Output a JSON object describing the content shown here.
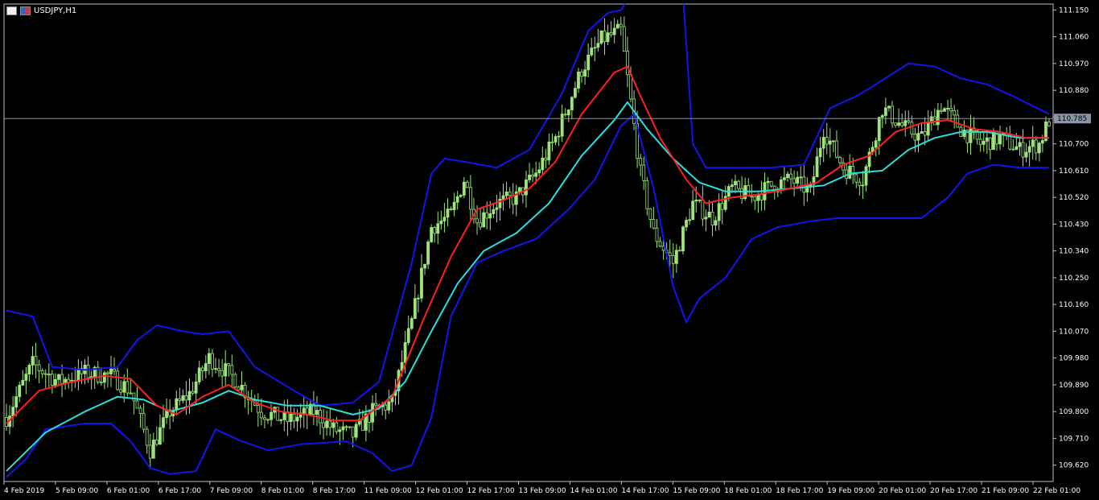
{
  "window": {
    "symbol_title": "USDJPY,H1",
    "icons": [
      "chart-window-icon",
      "flag-icon"
    ]
  },
  "colors": {
    "background": "#000000",
    "frame": "#c0c0c0",
    "candle_body": "#9ee57a",
    "candle_bear": "#000000",
    "bollinger": "#1414f0",
    "ma_fast": "#ff2020",
    "ma_slow": "#28e0e0",
    "price_line": "#8a96a8",
    "price_label_bg": "#8a96a8"
  },
  "chart_data": {
    "type": "candlestick",
    "symbol": "USDJPY",
    "timeframe": "H1",
    "current_price": 110.785,
    "y_range": [
      109.565,
      111.17
    ],
    "y_ticks": [
      "111.150",
      "111.060",
      "110.970",
      "110.880",
      "110.790",
      "110.700",
      "110.610",
      "110.520",
      "110.430",
      "110.340",
      "110.250",
      "110.160",
      "110.070",
      "109.980",
      "109.890",
      "109.800",
      "109.710",
      "109.620"
    ],
    "x_ticks": [
      "4 Feb 2019",
      "5 Feb 09:00",
      "6 Feb 01:00",
      "6 Feb 17:00",
      "7 Feb 09:00",
      "8 Feb 01:00",
      "8 Feb 17:00",
      "11 Feb 09:00",
      "12 Feb 01:00",
      "12 Feb 17:00",
      "13 Feb 09:00",
      "14 Feb 01:00",
      "14 Feb 17:00",
      "15 Feb 09:00",
      "18 Feb 01:00",
      "18 Feb 17:00",
      "19 Feb 09:00",
      "20 Feb 01:00",
      "20 Feb 17:00",
      "21 Feb 09:00",
      "22 Feb 01:00"
    ],
    "candle_count": 320,
    "close_path": [
      [
        0,
        109.78
      ],
      [
        8,
        109.96
      ],
      [
        16,
        109.9
      ],
      [
        24,
        109.93
      ],
      [
        32,
        109.92
      ],
      [
        38,
        109.87
      ],
      [
        44,
        109.67
      ],
      [
        50,
        109.8
      ],
      [
        56,
        109.86
      ],
      [
        62,
        109.98
      ],
      [
        70,
        109.91
      ],
      [
        78,
        109.8
      ],
      [
        86,
        109.77
      ],
      [
        94,
        109.8
      ],
      [
        100,
        109.74
      ],
      [
        106,
        109.72
      ],
      [
        112,
        109.8
      ],
      [
        118,
        109.83
      ],
      [
        124,
        110.1
      ],
      [
        130,
        110.42
      ],
      [
        136,
        110.46
      ],
      [
        140,
        110.58
      ],
      [
        144,
        110.44
      ],
      [
        150,
        110.5
      ],
      [
        156,
        110.52
      ],
      [
        162,
        110.6
      ],
      [
        168,
        110.72
      ],
      [
        176,
        110.95
      ],
      [
        182,
        111.05
      ],
      [
        188,
        111.08
      ],
      [
        194,
        110.6
      ],
      [
        198,
        110.4
      ],
      [
        204,
        110.3
      ],
      [
        210,
        110.5
      ],
      [
        216,
        110.45
      ],
      [
        222,
        110.55
      ],
      [
        228,
        110.52
      ],
      [
        234,
        110.56
      ],
      [
        240,
        110.58
      ],
      [
        246,
        110.54
      ],
      [
        250,
        110.75
      ],
      [
        256,
        110.62
      ],
      [
        262,
        110.58
      ],
      [
        268,
        110.82
      ],
      [
        274,
        110.76
      ],
      [
        280,
        110.72
      ],
      [
        286,
        110.83
      ],
      [
        292,
        110.75
      ],
      [
        298,
        110.7
      ],
      [
        304,
        110.72
      ],
      [
        310,
        110.68
      ],
      [
        316,
        110.7
      ],
      [
        319,
        110.78
      ]
    ],
    "ma_fast_path": [
      [
        0,
        109.76
      ],
      [
        10,
        109.87
      ],
      [
        20,
        109.9
      ],
      [
        30,
        109.92
      ],
      [
        38,
        109.91
      ],
      [
        46,
        109.82
      ],
      [
        52,
        109.79
      ],
      [
        60,
        109.85
      ],
      [
        68,
        109.89
      ],
      [
        76,
        109.83
      ],
      [
        84,
        109.8
      ],
      [
        92,
        109.79
      ],
      [
        100,
        109.77
      ],
      [
        108,
        109.77
      ],
      [
        118,
        109.85
      ],
      [
        128,
        110.12
      ],
      [
        136,
        110.32
      ],
      [
        144,
        110.48
      ],
      [
        152,
        110.51
      ],
      [
        160,
        110.55
      ],
      [
        168,
        110.64
      ],
      [
        176,
        110.8
      ],
      [
        186,
        110.94
      ],
      [
        190,
        110.96
      ],
      [
        194,
        110.86
      ],
      [
        200,
        110.72
      ],
      [
        208,
        110.58
      ],
      [
        214,
        110.5
      ],
      [
        222,
        110.52
      ],
      [
        230,
        110.53
      ],
      [
        240,
        110.55
      ],
      [
        248,
        110.57
      ],
      [
        256,
        110.63
      ],
      [
        264,
        110.66
      ],
      [
        272,
        110.74
      ],
      [
        280,
        110.77
      ],
      [
        288,
        110.78
      ],
      [
        296,
        110.75
      ],
      [
        304,
        110.74
      ],
      [
        312,
        110.72
      ],
      [
        319,
        110.72
      ]
    ],
    "ma_slow_path": [
      [
        0,
        109.6
      ],
      [
        12,
        109.73
      ],
      [
        24,
        109.8
      ],
      [
        34,
        109.85
      ],
      [
        42,
        109.84
      ],
      [
        50,
        109.8
      ],
      [
        60,
        109.83
      ],
      [
        68,
        109.87
      ],
      [
        76,
        109.84
      ],
      [
        86,
        109.82
      ],
      [
        96,
        109.82
      ],
      [
        106,
        109.79
      ],
      [
        114,
        109.81
      ],
      [
        122,
        109.9
      ],
      [
        130,
        110.07
      ],
      [
        138,
        110.23
      ],
      [
        146,
        110.34
      ],
      [
        156,
        110.4
      ],
      [
        166,
        110.5
      ],
      [
        176,
        110.66
      ],
      [
        186,
        110.78
      ],
      [
        190,
        110.84
      ],
      [
        196,
        110.75
      ],
      [
        204,
        110.65
      ],
      [
        212,
        110.57
      ],
      [
        220,
        110.54
      ],
      [
        230,
        110.54
      ],
      [
        240,
        110.55
      ],
      [
        250,
        110.56
      ],
      [
        258,
        110.6
      ],
      [
        268,
        110.61
      ],
      [
        276,
        110.68
      ],
      [
        284,
        110.72
      ],
      [
        292,
        110.74
      ],
      [
        300,
        110.74
      ],
      [
        310,
        110.72
      ],
      [
        319,
        110.72
      ]
    ],
    "bb_upper_path": [
      [
        0,
        110.14
      ],
      [
        8,
        110.12
      ],
      [
        14,
        109.95
      ],
      [
        24,
        109.94
      ],
      [
        34,
        109.95
      ],
      [
        40,
        110.04
      ],
      [
        46,
        110.09
      ],
      [
        54,
        110.07
      ],
      [
        60,
        110.06
      ],
      [
        68,
        110.07
      ],
      [
        76,
        109.95
      ],
      [
        88,
        109.87
      ],
      [
        96,
        109.82
      ],
      [
        106,
        109.83
      ],
      [
        114,
        109.9
      ],
      [
        124,
        110.3
      ],
      [
        130,
        110.6
      ],
      [
        134,
        110.65
      ],
      [
        140,
        110.64
      ],
      [
        150,
        110.62
      ],
      [
        160,
        110.68
      ],
      [
        170,
        110.87
      ],
      [
        178,
        111.08
      ],
      [
        184,
        111.14
      ],
      [
        188,
        111.15
      ],
      [
        191,
        111.2
      ],
      [
        200,
        111.2
      ],
      [
        207,
        111.2
      ],
      [
        210,
        110.7
      ],
      [
        214,
        110.62
      ],
      [
        224,
        110.62
      ],
      [
        234,
        110.62
      ],
      [
        244,
        110.63
      ],
      [
        252,
        110.82
      ],
      [
        260,
        110.86
      ],
      [
        266,
        110.9
      ],
      [
        276,
        110.97
      ],
      [
        284,
        110.96
      ],
      [
        292,
        110.92
      ],
      [
        300,
        110.9
      ],
      [
        308,
        110.86
      ],
      [
        319,
        110.8
      ]
    ],
    "bb_lower_path": [
      [
        0,
        109.58
      ],
      [
        6,
        109.64
      ],
      [
        12,
        109.74
      ],
      [
        24,
        109.76
      ],
      [
        32,
        109.76
      ],
      [
        38,
        109.7
      ],
      [
        44,
        109.61
      ],
      [
        50,
        109.59
      ],
      [
        58,
        109.6
      ],
      [
        64,
        109.74
      ],
      [
        72,
        109.7
      ],
      [
        80,
        109.67
      ],
      [
        90,
        109.69
      ],
      [
        104,
        109.7
      ],
      [
        112,
        109.66
      ],
      [
        118,
        109.6
      ],
      [
        124,
        109.62
      ],
      [
        130,
        109.78
      ],
      [
        136,
        110.12
      ],
      [
        144,
        110.3
      ],
      [
        152,
        110.34
      ],
      [
        162,
        110.38
      ],
      [
        172,
        110.48
      ],
      [
        180,
        110.58
      ],
      [
        188,
        110.76
      ],
      [
        192,
        110.8
      ],
      [
        198,
        110.55
      ],
      [
        204,
        110.22
      ],
      [
        208,
        110.1
      ],
      [
        212,
        110.18
      ],
      [
        220,
        110.25
      ],
      [
        228,
        110.38
      ],
      [
        236,
        110.42
      ],
      [
        246,
        110.44
      ],
      [
        254,
        110.45
      ],
      [
        262,
        110.45
      ],
      [
        270,
        110.45
      ],
      [
        280,
        110.45
      ],
      [
        288,
        110.52
      ],
      [
        294,
        110.6
      ],
      [
        302,
        110.63
      ],
      [
        310,
        110.62
      ],
      [
        319,
        110.62
      ]
    ]
  }
}
